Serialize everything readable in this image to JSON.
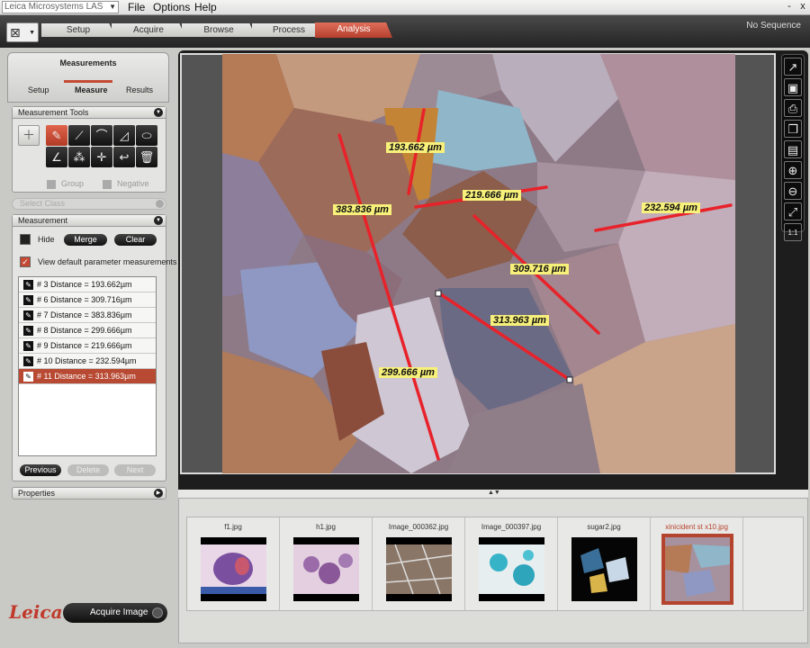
{
  "app": {
    "title": "Leica Microsystems LAS"
  },
  "menu": {
    "file": "File",
    "options": "Options",
    "help": "Help"
  },
  "window": {
    "minimize": "-",
    "close": "x"
  },
  "workflow_tabs": [
    "Setup",
    "Acquire",
    "Browse",
    "Process",
    "Analysis"
  ],
  "active_tab": "Analysis",
  "sequence_label": "No Sequence",
  "panel": {
    "title": "Measurements",
    "subtabs": [
      "Setup",
      "Measure",
      "Results"
    ],
    "active_subtab": "Measure",
    "tools_header": "Measurement Tools",
    "group_label": "Group",
    "negative_label": "Negative",
    "select_class": "Select Class",
    "measurement_header": "Measurement",
    "hide_label": "Hide",
    "merge_label": "Merge",
    "clear_label": "Clear",
    "default_params_label": "View default parameter measurements",
    "measurements": [
      "# 3  Distance = 193.662µm",
      "# 6  Distance = 309.716µm",
      "# 7  Distance = 383.836µm",
      "# 8  Distance = 299.666µm",
      "# 9  Distance = 219.666µm",
      "# 10  Distance = 232.594µm",
      "# 11  Distance = 313.963µm"
    ],
    "selected_measurement_index": 6,
    "previous_label": "Previous",
    "delete_label": "Delete",
    "next_label": "Next",
    "properties_label": "Properties"
  },
  "acquire_label": "Acquire Image",
  "logo_text": "Leica",
  "image_labels": [
    {
      "text": "193.662 µm"
    },
    {
      "text": "219.666 µm"
    },
    {
      "text": "232.594 µm"
    },
    {
      "text": "383.836 µm"
    },
    {
      "text": "309.716 µm"
    },
    {
      "text": "313.963 µm"
    },
    {
      "text": "299.666 µm"
    }
  ],
  "gallery": [
    {
      "name": "f1.jpg"
    },
    {
      "name": "h1.jpg"
    },
    {
      "name": "Image_000362.jpg"
    },
    {
      "name": "Image_000397.jpg"
    },
    {
      "name": "sugar2.jpg"
    },
    {
      "name": "xinicident st x10.jpg"
    }
  ],
  "selected_gallery_index": 5,
  "colors": {
    "accent": "#c44a35",
    "measure_line": "#e8222a",
    "label_bg": "#f7f07a"
  }
}
